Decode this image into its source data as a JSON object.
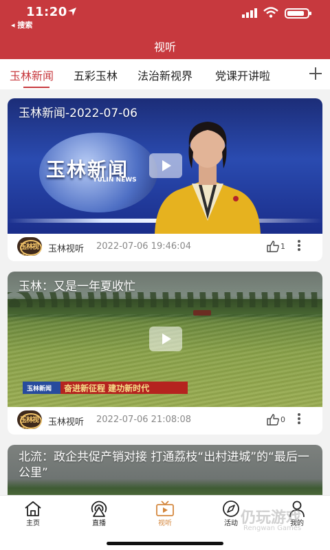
{
  "status_bar": {
    "time": "11:20",
    "back_label": "◂ 搜索"
  },
  "header": {
    "title": "视听"
  },
  "tabs": [
    {
      "label": "玉林新闻"
    },
    {
      "label": "五彩玉林"
    },
    {
      "label": "法治新视界"
    },
    {
      "label": "党课开讲啦"
    }
  ],
  "cards": [
    {
      "title": "玉林新闻-2022-07-06",
      "logo_text": "玉林新闻",
      "logo_en": "YULIN NEWS",
      "avatar_text": "玉林视听",
      "source": "玉林视听",
      "time": "2022-07-06 19:46:04",
      "likes": "1"
    },
    {
      "title": "玉林：又是一年夏收忙",
      "banner_logo": "玉林新闻",
      "banner_text": "奋进新征程  建功新时代",
      "avatar_text": "玉林视听",
      "source": "玉林视听",
      "time": "2022-07-06 21:08:08",
      "likes": "0"
    },
    {
      "title": "北流：政企共促产销对接 打通荔枝“出村进城”的“最后一公里”"
    }
  ],
  "bottom_nav": [
    {
      "label": "主页",
      "icon": "home-icon"
    },
    {
      "label": "直播",
      "icon": "live-icon"
    },
    {
      "label": "视听",
      "icon": "tv-icon"
    },
    {
      "label": "活动",
      "icon": "activity-icon"
    },
    {
      "label": "我的",
      "icon": "user-icon"
    }
  ],
  "watermark": {
    "text": "仍玩游戏",
    "sub": "Rengwan Games"
  },
  "colors": {
    "brand_red": "#c7393e",
    "active_nav": "#d4873d"
  }
}
